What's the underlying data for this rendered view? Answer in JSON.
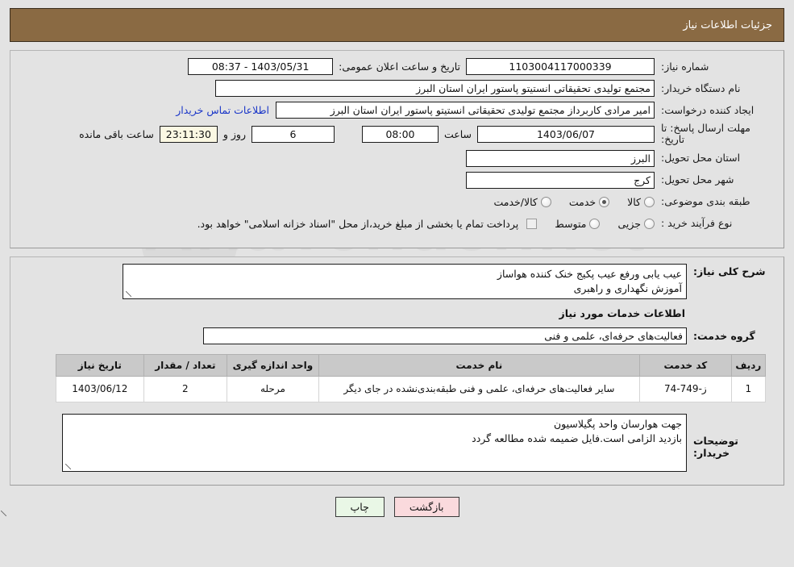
{
  "header": {
    "title": "جزئیات اطلاعات نیاز"
  },
  "form": {
    "need_number_label": "شماره نیاز:",
    "need_number_value": "1103004117000339",
    "public_announce_label": "تاریخ و ساعت اعلان عمومی:",
    "public_announce_value": "1403/05/31 - 08:37",
    "buyer_org_label": "نام دستگاه خریدار:",
    "buyer_org_value": "مجتمع تولیدی تحقیقاتی انستیتو پاستور ایران استان البرز",
    "creator_label": "ایجاد کننده درخواست:",
    "creator_value": "امیر مرادی کاربرداز مجتمع تولیدی تحقیقاتی انستیتو پاستور ایران استان البرز",
    "contact_link": "اطلاعات تماس خریدار",
    "deadline_label": "مهلت ارسال پاسخ: تا تاریخ:",
    "deadline_date": "1403/06/07",
    "hour_word": "ساعت",
    "deadline_time": "08:00",
    "days_remaining": "6",
    "days_word": "روز و",
    "time_remaining": "23:11:30",
    "remaining_suffix": "ساعت باقی مانده",
    "province_label": "استان محل تحویل:",
    "province_value": "البرز",
    "city_label": "شهر محل تحویل:",
    "city_value": "کرج",
    "classification_label": "طبقه بندی موضوعی:",
    "classification_options": [
      {
        "label": "کالا",
        "checked": false
      },
      {
        "label": "خدمت",
        "checked": true
      },
      {
        "label": "کالا/خدمت",
        "checked": false
      }
    ],
    "process_label": "نوع فرآیند خرید :",
    "process_options": [
      {
        "label": "جزیی",
        "checked": false
      },
      {
        "label": "متوسط",
        "checked": false
      }
    ],
    "treasury_note": "پرداخت تمام یا بخشی از مبلغ خرید،از محل \"اسناد خزانه اسلامی\" خواهد بود.",
    "treasury_checked": false
  },
  "details": {
    "general_desc_label": "شرح کلی نیاز:",
    "general_desc_value": "عیب یابی ورفع عیب پکیج خنک کننده هواساز\nآموزش نگهداری و راهبری",
    "services_section_title": "اطلاعات خدمات مورد نیاز",
    "service_group_label": "گروه خدمت:",
    "service_group_value": "فعالیت‌های حرفه‌ای، علمی و فنی"
  },
  "table": {
    "headers": [
      "ردیف",
      "کد خدمت",
      "نام خدمت",
      "واحد اندازه گیری",
      "تعداد / مقدار",
      "تاریخ نیاز"
    ],
    "rows": [
      {
        "radif": "1",
        "code": "ز-749-74",
        "name": "سایر فعالیت‌های حرفه‌ای، علمی و فنی طبقه‌بندی‌نشده در جای دیگر",
        "unit": "مرحله",
        "qty": "2",
        "date": "1403/06/12"
      }
    ]
  },
  "notes": {
    "buyer_notes_label": "توضیحات خریدار:",
    "buyer_notes_value": "جهت هوارسان واحد پگیلاسیون\nبازدید الزامی است.فایل ضمیمه شده مطالعه گردد"
  },
  "buttons": {
    "back": "بازگشت",
    "print": "چاپ"
  },
  "colors": {
    "header_bg": "#8a6a43",
    "page_bg": "#e3e3e3",
    "link": "#1a36c8",
    "back_btn": "#fadadd",
    "print_btn": "#e9f7e6"
  }
}
